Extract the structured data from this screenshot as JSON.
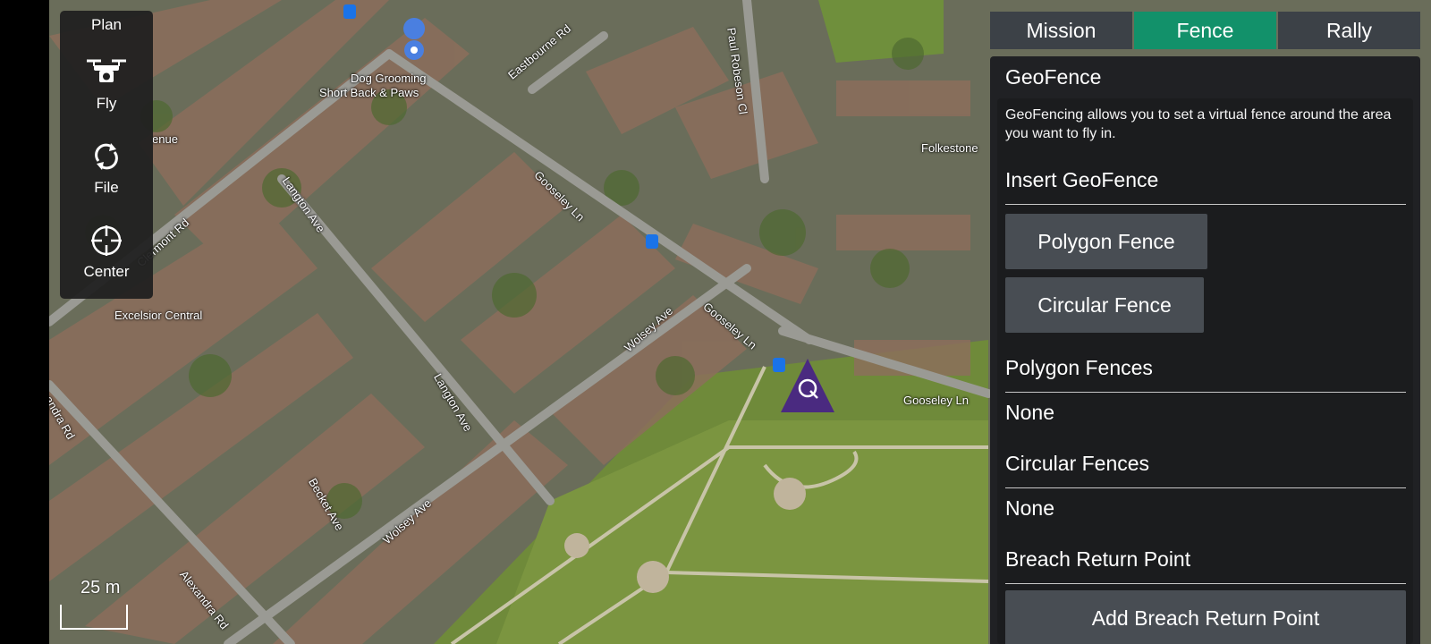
{
  "toolbar": {
    "plan_label": "Plan",
    "fly_label": "Fly",
    "file_label": "File",
    "center_label": "Center"
  },
  "map": {
    "labels": {
      "dog_grooming_1": "Dog Grooming",
      "dog_grooming_2": "Short Back & Paws",
      "eastbourne_rd": "Eastbourne Rd",
      "paul_robeson_cl": "Paul Robeson Cl",
      "folkestone": "Folkestone",
      "venue": "enue",
      "clermont_rd": "Clermont Rd",
      "langton_ave_1": "Langton Ave",
      "gooseley_ln_1": "Gooseley Ln",
      "excelsior_central": "Excelsior Central",
      "wolsey_ave_1": "Wolsey Ave",
      "gooseley_ln_2": "Gooseley Ln",
      "langton_ave_2": "Langton Ave",
      "gooseley_ln_3": "Gooseley Ln",
      "andra_rd": "andra Rd",
      "becket_ave": "Becket Ave",
      "wolsey_ave_2": "Wolsey Ave",
      "alexandra_rd": "Alexandra Rd"
    },
    "scale_text": "25 m"
  },
  "tabs": {
    "mission": "Mission",
    "fence": "Fence",
    "rally": "Rally",
    "active": "Fence"
  },
  "panel": {
    "title": "GeoFence",
    "description": "GeoFencing allows you to set a virtual fence around the area you want to fly in.",
    "insert_heading": "Insert GeoFence",
    "polygon_button": "Polygon Fence",
    "circular_button": "Circular Fence",
    "polygon_fences_heading": "Polygon Fences",
    "polygon_fences_value": "None",
    "circular_fences_heading": "Circular Fences",
    "circular_fences_value": "None",
    "breach_heading": "Breach Return Point",
    "breach_button": "Add Breach Return Point"
  },
  "colors": {
    "active_tab": "#12916a",
    "vehicle": "#4a2a80"
  }
}
